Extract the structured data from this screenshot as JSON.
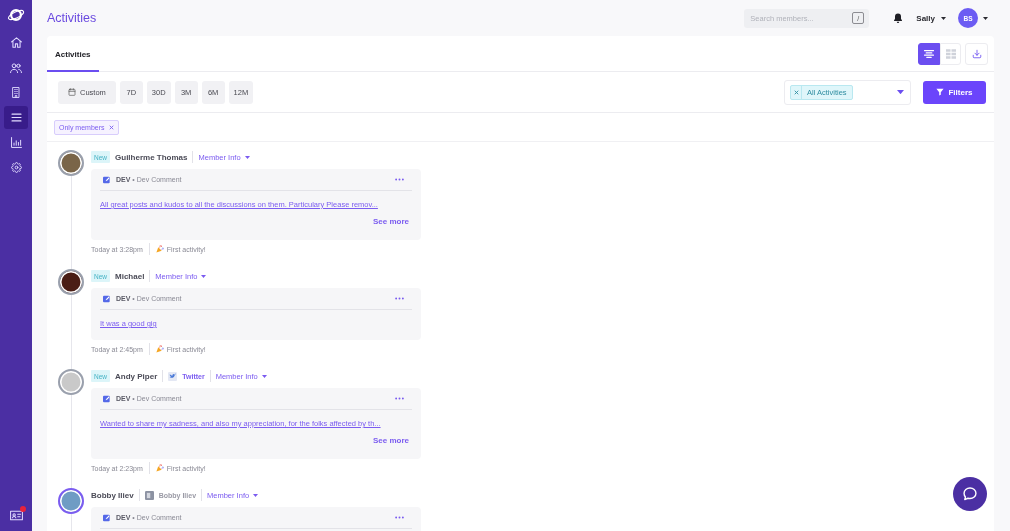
{
  "sidebar": {
    "items": [
      {
        "selected": false
      },
      {
        "selected": false
      },
      {
        "selected": false
      },
      {
        "selected": true
      },
      {
        "selected": false
      },
      {
        "selected": false
      }
    ],
    "bottom_item": {
      "notification": true
    }
  },
  "header": {
    "title": "Activities",
    "search": {
      "placeholder": "Search members...",
      "shortcut": "/"
    },
    "user": {
      "name": "Sally",
      "initials": "BS"
    }
  },
  "tabs": [
    {
      "label": "Activities",
      "selected": true
    }
  ],
  "view_toggle": [
    {
      "selected": true
    },
    {
      "selected": false
    }
  ],
  "date_ranges": [
    {
      "kind": "custom",
      "label": "Custom",
      "selected": false
    },
    {
      "kind": "preset",
      "label": "7D",
      "selected": false
    },
    {
      "kind": "preset",
      "label": "30D",
      "selected": false
    },
    {
      "kind": "preset",
      "label": "3M",
      "selected": false
    },
    {
      "kind": "preset",
      "label": "6M",
      "selected": false
    },
    {
      "kind": "preset",
      "label": "12M",
      "selected": false
    }
  ],
  "activity_filter": {
    "tags": [
      {
        "label": "All Activities"
      }
    ]
  },
  "filters_button": {
    "label": "Filters"
  },
  "active_filters": [
    {
      "label": "Only members"
    }
  ],
  "activities": [
    {
      "badge": "New",
      "name": "Guilherme Thomas",
      "member_info": "Member Info",
      "avatar_highlighted": false,
      "source": "**DEV** • Dev Comment",
      "body": "All great posts and kudos to all the discussions on them. Particulary Please remov...",
      "see_more": "See more",
      "time": "Today at 3:28pm",
      "note": "First activity!"
    },
    {
      "badge": "New",
      "name": "Michael",
      "member_info": "Member Info",
      "avatar_highlighted": false,
      "source": "**DEV** • Dev Comment",
      "body": "It was a good gig",
      "time": "Today at 2:45pm",
      "note": "First activity!"
    },
    {
      "badge": "New",
      "name": "Andy Piper",
      "channel": {
        "kind": "twitter",
        "label": "Twitter"
      },
      "member_info": "Member Info",
      "avatar_highlighted": false,
      "source": "**DEV** • Dev Comment",
      "body": "Wanted to share my sadness, and also my appreciation, for the folks affected by th...",
      "see_more": "See more",
      "time": "Today at 2:23pm",
      "note": "First activity!"
    },
    {
      "name": "Bobby Iliev",
      "channel": {
        "kind": "profile",
        "label": "Bobby Iliev"
      },
      "member_info": "Member Info",
      "avatar_highlighted": true,
      "source": "**DEV** • Dev Comment"
    }
  ]
}
